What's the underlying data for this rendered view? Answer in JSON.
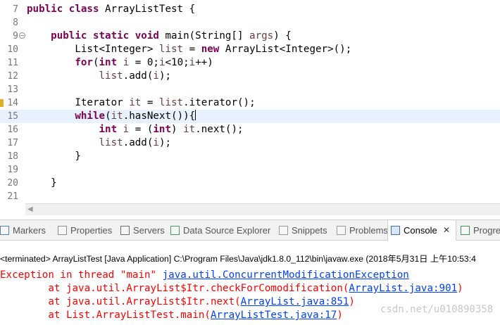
{
  "editor": {
    "lines": [
      {
        "n": "7",
        "segments": [
          {
            "t": "public class",
            "c": "kw"
          },
          {
            "t": " ArrayListTest {"
          }
        ]
      },
      {
        "n": "8",
        "segments": []
      },
      {
        "n": "9",
        "fold": "−",
        "segments": [
          {
            "t": "    "
          },
          {
            "t": "public static void",
            "c": "kw"
          },
          {
            "t": " main(String[] "
          },
          {
            "t": "args",
            "c": "var"
          },
          {
            "t": ") {"
          }
        ]
      },
      {
        "n": "10",
        "segments": [
          {
            "t": "        List<Integer> "
          },
          {
            "t": "list",
            "c": "var"
          },
          {
            "t": " = "
          },
          {
            "t": "new",
            "c": "kw"
          },
          {
            "t": " ArrayList<Integer>();"
          }
        ]
      },
      {
        "n": "11",
        "segments": [
          {
            "t": "        "
          },
          {
            "t": "for",
            "c": "kw"
          },
          {
            "t": "("
          },
          {
            "t": "int",
            "c": "kw"
          },
          {
            "t": " "
          },
          {
            "t": "i",
            "c": "var"
          },
          {
            "t": " = 0;"
          },
          {
            "t": "i",
            "c": "var"
          },
          {
            "t": "<10;"
          },
          {
            "t": "i",
            "c": "var"
          },
          {
            "t": "++)"
          }
        ]
      },
      {
        "n": "12",
        "segments": [
          {
            "t": "            "
          },
          {
            "t": "list",
            "c": "var"
          },
          {
            "t": ".add("
          },
          {
            "t": "i",
            "c": "var"
          },
          {
            "t": ");"
          }
        ]
      },
      {
        "n": "13",
        "segments": []
      },
      {
        "n": "14",
        "warning": true,
        "segments": [
          {
            "t": "        Iterator "
          },
          {
            "t": "it",
            "c": "var"
          },
          {
            "t": " = "
          },
          {
            "t": "list",
            "c": "var"
          },
          {
            "t": ".iterator();"
          }
        ]
      },
      {
        "n": "15",
        "current": true,
        "caret": true,
        "segments": [
          {
            "t": "        "
          },
          {
            "t": "while",
            "c": "kw"
          },
          {
            "t": "("
          },
          {
            "t": "it",
            "c": "var"
          },
          {
            "t": ".hasNext()){"
          }
        ]
      },
      {
        "n": "16",
        "segments": [
          {
            "t": "            "
          },
          {
            "t": "int",
            "c": "kw"
          },
          {
            "t": " "
          },
          {
            "t": "i",
            "c": "var"
          },
          {
            "t": " = ("
          },
          {
            "t": "int",
            "c": "kw"
          },
          {
            "t": ") "
          },
          {
            "t": "it",
            "c": "var"
          },
          {
            "t": ".next();"
          }
        ]
      },
      {
        "n": "17",
        "segments": [
          {
            "t": "            "
          },
          {
            "t": "list",
            "c": "var"
          },
          {
            "t": ".add("
          },
          {
            "t": "i",
            "c": "var"
          },
          {
            "t": ");"
          }
        ]
      },
      {
        "n": "18",
        "segments": [
          {
            "t": "        }"
          }
        ]
      },
      {
        "n": "19",
        "segments": []
      },
      {
        "n": "20",
        "segments": [
          {
            "t": "    }"
          }
        ]
      },
      {
        "n": "21",
        "segments": []
      }
    ]
  },
  "panel": {
    "tabs": [
      {
        "id": "markers",
        "label": "Markers",
        "icon": "markers-icon"
      },
      {
        "id": "properties",
        "label": "Properties",
        "icon": "properties-icon"
      },
      {
        "id": "servers",
        "label": "Servers",
        "icon": "servers-icon"
      },
      {
        "id": "data-source-explorer",
        "label": "Data Source Explorer",
        "icon": "database-icon"
      },
      {
        "id": "snippets",
        "label": "Snippets",
        "icon": "snippets-icon"
      },
      {
        "id": "problems",
        "label": "Problems",
        "icon": "problems-icon"
      },
      {
        "id": "console",
        "label": "Console",
        "icon": "console-icon",
        "active": true,
        "close": "✕"
      },
      {
        "id": "progress",
        "label": "Progre",
        "icon": "progress-icon"
      }
    ]
  },
  "console": {
    "terminated": "<terminated> ArrayListTest [Java Application] C:\\Program Files\\Java\\jdk1.8.0_112\\bin\\javaw.exe (2018年5月31日 上午10:53:4",
    "lines": [
      {
        "segments": [
          {
            "t": "Exception in thread \"main\" "
          },
          {
            "t": "java.util.ConcurrentModificationException",
            "c": "link"
          }
        ]
      },
      {
        "segments": [
          {
            "t": "        at java.util.ArrayList$Itr.checkForComodification("
          },
          {
            "t": "ArrayList.java:901",
            "c": "link"
          },
          {
            "t": ")"
          }
        ]
      },
      {
        "segments": [
          {
            "t": "        at java.util.ArrayList$Itr.next("
          },
          {
            "t": "ArrayList.java:851",
            "c": "link"
          },
          {
            "t": ")"
          }
        ]
      },
      {
        "segments": [
          {
            "t": "        at List.ArrayListTest.main("
          },
          {
            "t": "ArrayListTest.java:17",
            "c": "link"
          },
          {
            "t": ")"
          }
        ]
      }
    ],
    "watermark": "csdn.net/u010890358"
  },
  "colors": {
    "keyword": "#7f0055",
    "variable": "#6a3e3e",
    "error": "#ff0000",
    "link": "#0040ff",
    "current_line": "#e8f2fe"
  }
}
